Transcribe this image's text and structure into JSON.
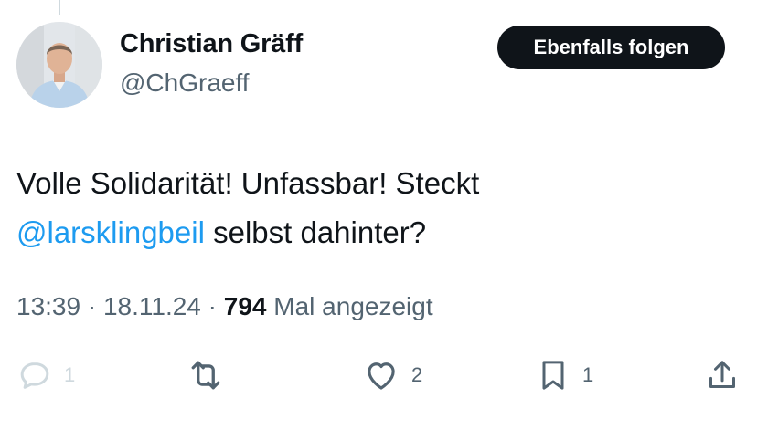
{
  "tweet": {
    "author_name": "Christian Gräff",
    "author_handle": "@ChGraeff",
    "follow_label": "Ebenfalls folgen",
    "text_before_line1": "Volle Solidarität! Unfassbar! Steckt",
    "mention": "@larsklingbeil",
    "text_after_mention": " selbst dahinter?",
    "time": "13:39",
    "date": "18.11.24",
    "views": "794",
    "views_label": "Mal angezeigt"
  },
  "actions": {
    "reply": {
      "icon": "reply-icon",
      "count": "1"
    },
    "retweet": {
      "icon": "retweet-icon",
      "count": ""
    },
    "like": {
      "icon": "heart-icon",
      "count": "2"
    },
    "bookmark": {
      "icon": "bookmark-icon",
      "count": "1"
    },
    "share": {
      "icon": "share-icon",
      "count": ""
    }
  },
  "colors": {
    "text": "#0f1419",
    "secondary": "#536471",
    "link": "#1d9bf0",
    "button_bg": "#0f1419",
    "button_text": "#ffffff"
  }
}
